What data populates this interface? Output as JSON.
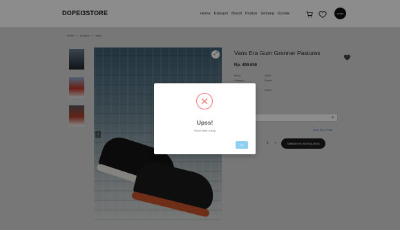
{
  "header": {
    "brand": "DOPEI3STORE",
    "nav": [
      "Home",
      "Kategori",
      "Brand",
      "Produk",
      "Tentang",
      "Kontak"
    ],
    "avatar_text": "ADMIN"
  },
  "breadcrumb": [
    "Home",
    ">",
    "product",
    ">",
    "vans"
  ],
  "product": {
    "title": "Vans Era Gum Grenner Pastures",
    "price": "Rp. 499.000",
    "specs": [
      {
        "key": "Brand",
        "value": "VANS"
      },
      {
        "key": "Category",
        "value": "Sepatu"
      },
      {
        "key": "",
        "value": "-"
      },
      {
        "key": "",
        "value": "Green"
      }
    ],
    "size_select_value": "",
    "size_chart_label": "Lihat Size Chart",
    "qty": "1",
    "qty_minus": "-",
    "qty_plus": "+",
    "add_to_cart_label": "TAMBAH KE KERANJANG"
  },
  "modal": {
    "title": "Upss!",
    "message": "Stock tidak cukup",
    "ok_label": "OK"
  },
  "colors": {
    "error": "#f27474",
    "ok_button": "#8fd0f0",
    "overlay": "rgba(0,0,0,0.45)"
  },
  "icons": [
    "cart-icon",
    "heart-icon",
    "close-icon",
    "expand-icon",
    "chevron-left-icon",
    "chevron-down-icon"
  ]
}
